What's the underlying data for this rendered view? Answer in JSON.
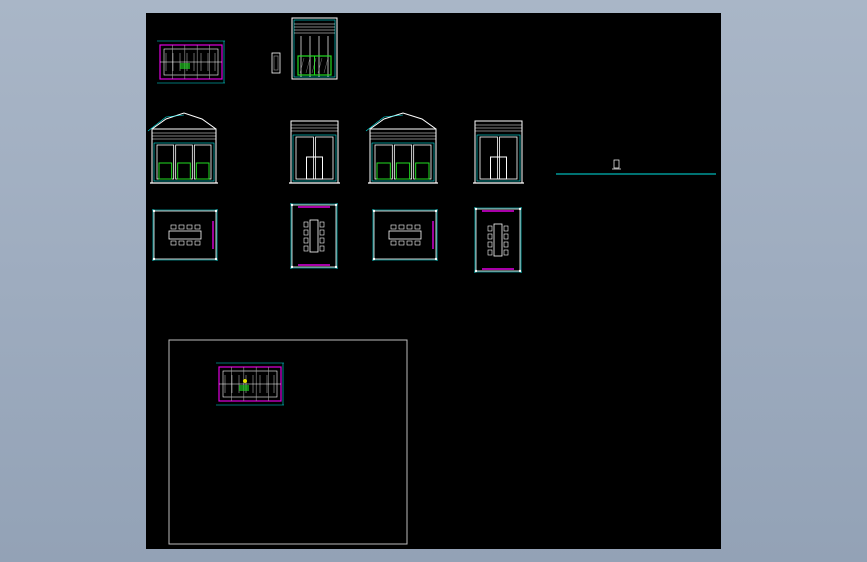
{
  "colors": {
    "background": "#a3b1c3",
    "viewport": "#000000",
    "white": "#ffffff",
    "cyan": "#00e5e5",
    "magenta": "#e000e0",
    "green": "#22dd22",
    "gray": "#9a9a9a",
    "yellow": "#e6e600"
  },
  "drawing": {
    "views": [
      {
        "kind": "plan-small",
        "name": "floor-plan-thumbnail"
      },
      {
        "kind": "tag",
        "name": "small-detail-tag"
      },
      {
        "kind": "elevation-tall",
        "name": "front-elevation-tall"
      },
      {
        "kind": "elevation-gable",
        "name": "elevation-a"
      },
      {
        "kind": "elevation-flat",
        "name": "elevation-b"
      },
      {
        "kind": "elevation-gable",
        "name": "elevation-c"
      },
      {
        "kind": "elevation-flat",
        "name": "elevation-d"
      },
      {
        "kind": "table-plan-wide",
        "name": "meeting-table-plan-1"
      },
      {
        "kind": "table-plan-tall",
        "name": "meeting-table-plan-2"
      },
      {
        "kind": "table-plan-wide",
        "name": "meeting-table-plan-3"
      },
      {
        "kind": "table-plan-tall",
        "name": "meeting-table-plan-4"
      },
      {
        "kind": "section-line",
        "name": "section-line"
      },
      {
        "kind": "layout-frame",
        "name": "layout-frame"
      },
      {
        "kind": "plan-small",
        "name": "floor-plan-in-frame"
      }
    ]
  }
}
